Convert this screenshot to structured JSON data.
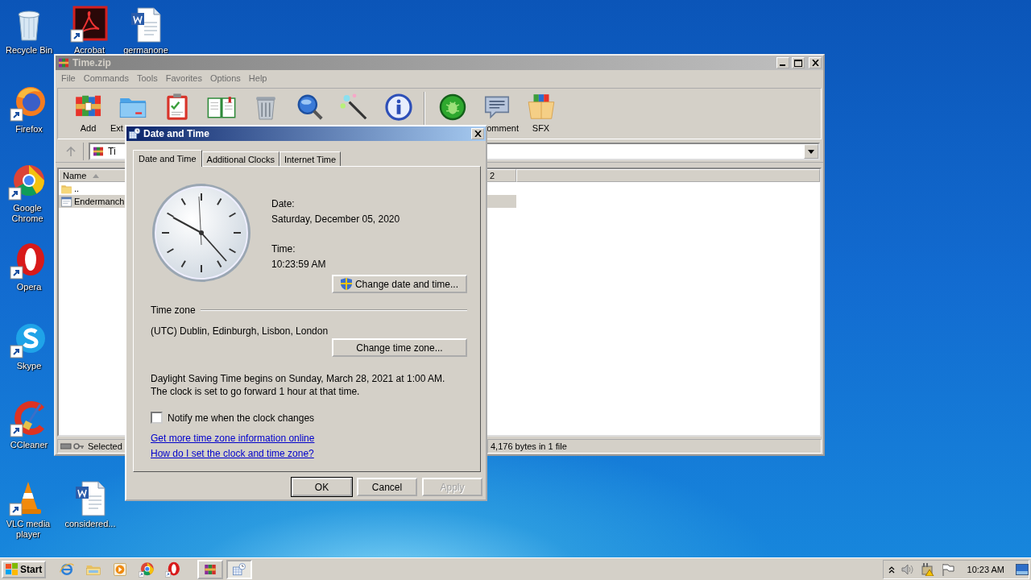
{
  "desktop": {
    "icons": [
      {
        "label": "Recycle Bin",
        "kind": "recycle"
      },
      {
        "label": "Acrobat",
        "kind": "acrobat"
      },
      {
        "label": "germanone",
        "kind": "word"
      },
      {
        "label": "Firefox",
        "kind": "firefox"
      },
      {
        "label": "Google Chrome",
        "kind": "chrome"
      },
      {
        "label": "Opera",
        "kind": "opera"
      },
      {
        "label": "Skype",
        "kind": "skype"
      },
      {
        "label": "CCleaner",
        "kind": "ccleaner"
      },
      {
        "label": "VLC media player",
        "kind": "vlc"
      },
      {
        "label": "considered...",
        "kind": "word"
      }
    ]
  },
  "archiver": {
    "title": "Time.zip",
    "menu": [
      "File",
      "Commands",
      "Tools",
      "Favorites",
      "Options",
      "Help"
    ],
    "toolbar": [
      {
        "kind": "add",
        "label": "Add"
      },
      {
        "kind": "extract",
        "label": "Ext"
      },
      {
        "kind": "test"
      },
      {
        "kind": "view"
      },
      {
        "kind": "delete"
      },
      {
        "kind": "find"
      },
      {
        "kind": "wizard"
      },
      {
        "kind": "info"
      },
      {
        "kind": "scan"
      },
      {
        "kind": "comment",
        "label": "omment"
      },
      {
        "kind": "sfx",
        "label": "SFX"
      }
    ],
    "path": "Ti",
    "columns": [
      "Name",
      "2"
    ],
    "rows": [
      {
        "name": "..",
        "kind": "folder",
        "selected": false
      },
      {
        "name": "Endermanch",
        "kind": "file",
        "selected": true
      }
    ],
    "status_left": "Selected",
    "status_right": "4,176 bytes in 1 file"
  },
  "dialog": {
    "title": "Date and Time",
    "tabs": [
      {
        "label": "Date and Time",
        "selected": true
      },
      {
        "label": "Additional Clocks",
        "selected": false
      },
      {
        "label": "Internet Time",
        "selected": false
      }
    ],
    "date_label": "Date:",
    "date": "Saturday, December 05, 2020",
    "time_label": "Time:",
    "time": "10:23:59 AM",
    "change_datetime": "Change date and time...",
    "timezone_heading": "Time zone",
    "timezone": "(UTC) Dublin, Edinburgh, Lisbon, London",
    "change_timezone": "Change time zone...",
    "dst_note": "Daylight Saving Time begins on Sunday, March 28, 2021 at 1:00 AM. The clock is set to go forward 1 hour at that time.",
    "notify": {
      "label": "Notify me when the clock changes",
      "checked": false
    },
    "links": [
      "Get more time zone information online",
      "How do I set the clock and time zone?"
    ],
    "buttons": [
      {
        "label": "OK",
        "disabled": false
      },
      {
        "label": "Cancel",
        "disabled": false
      },
      {
        "label": "Apply",
        "disabled": true
      }
    ]
  },
  "taskbar": {
    "start": "Start",
    "quick_launch": [
      {
        "kind": "ie"
      },
      {
        "kind": "explorer"
      },
      {
        "kind": "media"
      },
      {
        "kind": "chrome"
      },
      {
        "kind": "opera"
      }
    ],
    "tasks": [
      {
        "kind": "winrar",
        "selected": false
      },
      {
        "kind": "datetime",
        "selected": true
      }
    ],
    "clock": "10:23 AM"
  }
}
